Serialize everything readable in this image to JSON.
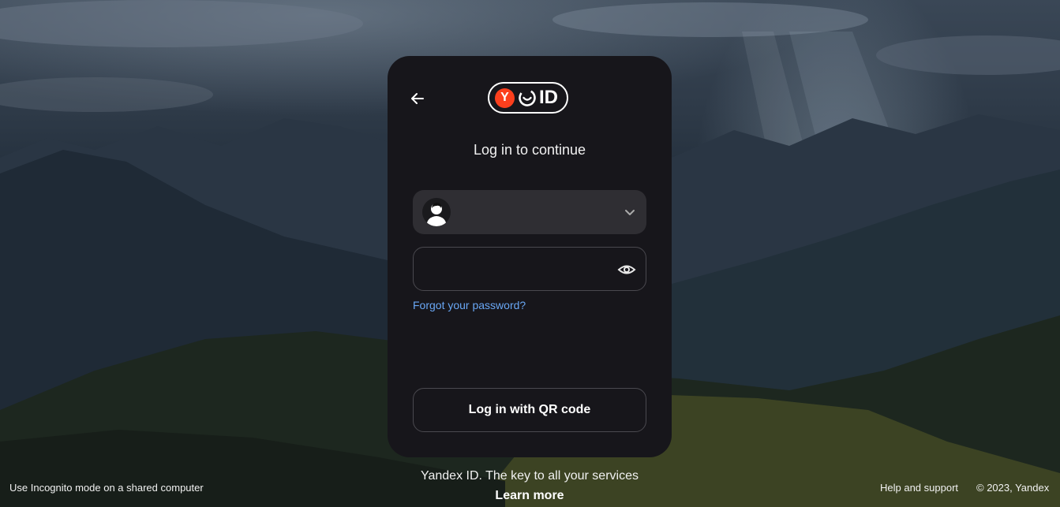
{
  "card": {
    "logo": {
      "y_letter": "Y",
      "id_text": "ID"
    },
    "title": "Log in to continue",
    "account_select": {
      "selected": ""
    },
    "password": {
      "value": "",
      "placeholder": ""
    },
    "forgot_password": "Forgot your password?",
    "qr_button": "Log in with QR code"
  },
  "footer": {
    "tagline": "Yandex ID. The key to all your services",
    "learn_more": "Learn more",
    "incognito_note": "Use Incognito mode on a shared computer",
    "help": "Help and support",
    "copyright": "© 2023, Yandex"
  },
  "colors": {
    "card_bg": "#17161b",
    "field_bg": "#2f2e33",
    "link": "#69a7f5",
    "logo_red": "#fc3f1d"
  },
  "icons": [
    "back-arrow-icon",
    "yandex-y-icon",
    "smile-icon",
    "user-avatar-icon",
    "chevron-down-icon",
    "eye-icon"
  ]
}
